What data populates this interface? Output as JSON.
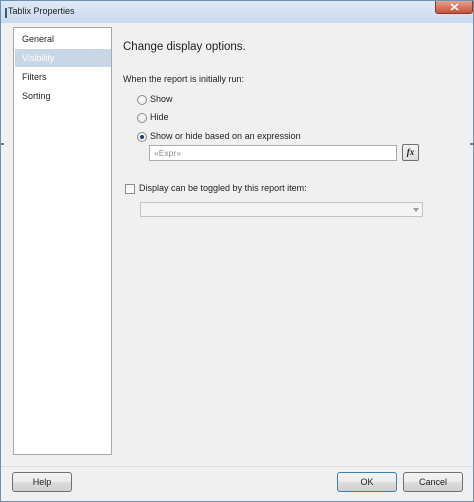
{
  "window": {
    "title": "Tablix Properties"
  },
  "nav": {
    "items": [
      {
        "label": "General",
        "selected": false
      },
      {
        "label": "Visibility",
        "selected": true
      },
      {
        "label": "Filters",
        "selected": false
      },
      {
        "label": "Sorting",
        "selected": false
      }
    ]
  },
  "visibility": {
    "heading": "Change display options.",
    "initial_label": "When the report is initially run:",
    "options": [
      {
        "label": "Show",
        "checked": false
      },
      {
        "label": "Hide",
        "checked": false
      },
      {
        "label": "Show or hide based on an expression",
        "checked": true
      }
    ],
    "expression_value": "«Expr»",
    "fx_label": "fx",
    "toggle_label": "Display can be toggled by this report item:",
    "toggle_checked": false,
    "toggle_combo_value": ""
  },
  "footer": {
    "help_label": "Help",
    "ok_label": "OK",
    "cancel_label": "Cancel"
  },
  "colors": {
    "selected_nav": "#c9d6e5",
    "close_button": "#c65138",
    "default_button_border": "#3c7fb1"
  }
}
